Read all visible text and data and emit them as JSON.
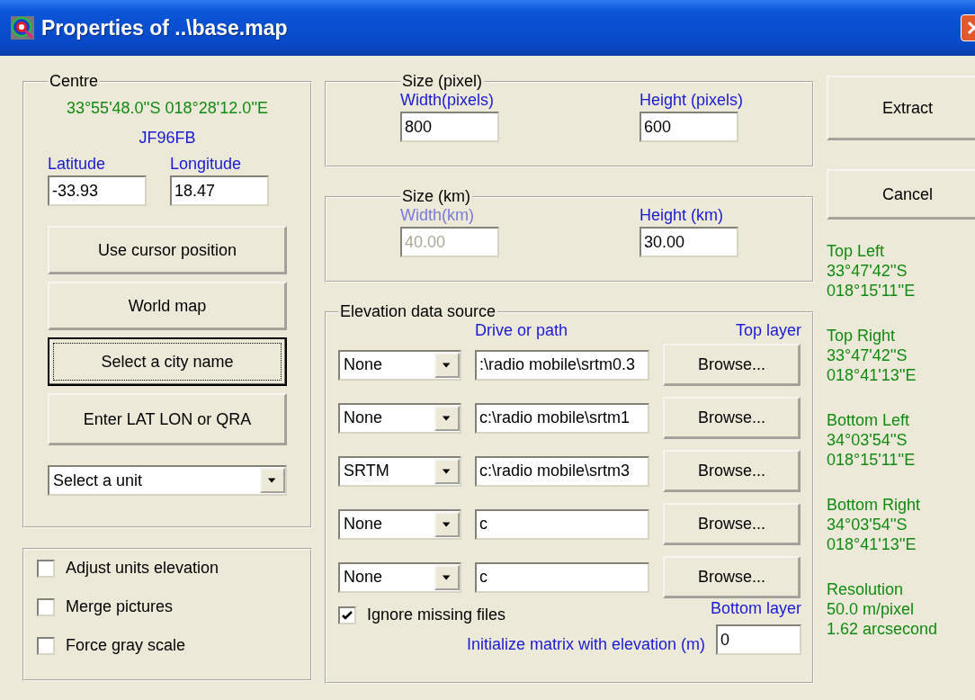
{
  "window": {
    "title": "Properties of ..\\base.map"
  },
  "centre": {
    "legend": "Centre",
    "coordinates": "33°55'48.0''S 018°28'12.0''E",
    "locator": "JF96FB",
    "latitude": {
      "label": "Latitude",
      "value": "-33.93"
    },
    "longitude": {
      "label": "Longitude",
      "value": "18.47"
    },
    "buttons": [
      {
        "label": "Use cursor position",
        "focused": false
      },
      {
        "label": "World map",
        "focused": false
      },
      {
        "label": "Select a city name",
        "focused": true
      },
      {
        "label": "Enter LAT LON or QRA",
        "focused": false
      }
    ],
    "unit_select": {
      "value": "Select a unit"
    }
  },
  "options": [
    {
      "label": "Adjust units elevation",
      "checked": false
    },
    {
      "label": "Merge pictures",
      "checked": false
    },
    {
      "label": "Force gray scale",
      "checked": false
    }
  ],
  "size_pixel": {
    "legend": "Size (pixel)",
    "fields": [
      {
        "label": "Width(pixels)",
        "value": "800",
        "disabled": false
      },
      {
        "label": "Height (pixels)",
        "value": "600",
        "disabled": false
      }
    ]
  },
  "size_km": {
    "legend": "Size (km)",
    "fields": [
      {
        "label": "Width(km)",
        "value": "40.00",
        "disabled": true
      },
      {
        "label": "Height (km)",
        "value": "30.00",
        "disabled": false
      }
    ]
  },
  "elevation": {
    "legend": "Elevation data source",
    "path_header": "Drive or path",
    "top_label": "Top layer",
    "rows": [
      {
        "source": "None",
        "path": ":\\radio mobile\\srtm0.3",
        "button": "Browse..."
      },
      {
        "source": "None",
        "path": "c:\\radio mobile\\srtm1",
        "button": "Browse..."
      },
      {
        "source": "SRTM",
        "path": "c:\\radio mobile\\srtm3",
        "button": "Browse..."
      },
      {
        "source": "None",
        "path": "c",
        "button": "Browse..."
      },
      {
        "source": "None",
        "path": "c",
        "button": "Browse..."
      }
    ],
    "ignore_missing": {
      "label": "Ignore missing files",
      "checked": true
    },
    "bottom_label": "Bottom layer",
    "init": {
      "label": "Initialize matrix with elevation (m)",
      "value": "0"
    }
  },
  "actions": [
    {
      "label": "Extract"
    },
    {
      "label": "Cancel"
    }
  ],
  "corners": [
    {
      "label": "Top Left",
      "lines": [
        "33°47'42''S",
        "018°15'11''E"
      ]
    },
    {
      "label": "Top Right",
      "lines": [
        "33°47'42''S",
        "018°41'13''E"
      ]
    },
    {
      "label": "Bottom Left",
      "lines": [
        "34°03'54''S",
        "018°15'11''E"
      ]
    },
    {
      "label": "Bottom Right",
      "lines": [
        "34°03'54''S",
        "018°41'13''E"
      ]
    },
    {
      "label": "Resolution",
      "lines": [
        "50.0 m/pixel",
        "1.62 arcsecond"
      ]
    }
  ]
}
